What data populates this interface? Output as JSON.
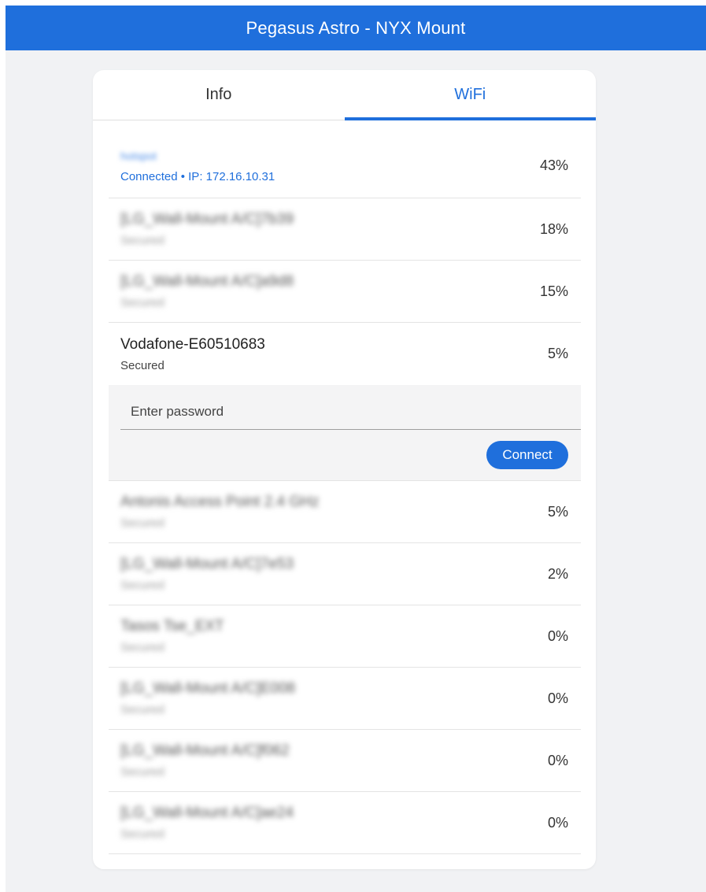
{
  "header": {
    "title": "Pegasus Astro - NYX Mount"
  },
  "tabs": [
    {
      "label": "Info",
      "active": false
    },
    {
      "label": "WiFi",
      "active": true
    }
  ],
  "colors": {
    "accent": "#1f6fdc",
    "background": "#f1f2f4"
  },
  "networks": [
    {
      "ssid": "hotspot",
      "status": "Connected • IP: 172.16.10.31",
      "signal": "43%",
      "connected": true,
      "blurred": true
    },
    {
      "ssid": "[LG_Wall-Mount A/C]7b39",
      "status": "Secured",
      "signal": "18%",
      "blurred": true
    },
    {
      "ssid": "[LG_Wall-Mount A/C]a9d8",
      "status": "Secured",
      "signal": "15%",
      "blurred": true
    },
    {
      "ssid": "Vodafone-E60510683",
      "status": "Secured",
      "signal": "5%",
      "blurred": false,
      "selected": true
    },
    {
      "ssid": "Antonis Access Point 2.4 GHz",
      "status": "Secured",
      "signal": "5%",
      "blurred": true
    },
    {
      "ssid": "[LG_Wall-Mount A/C]7e53",
      "status": "Secured",
      "signal": "2%",
      "blurred": true
    },
    {
      "ssid": "Tasos Tse_EXT",
      "status": "Secured",
      "signal": "0%",
      "blurred": true
    },
    {
      "ssid": "[LG_Wall-Mount A/C]E008",
      "status": "Secured",
      "signal": "0%",
      "blurred": true
    },
    {
      "ssid": "[LG_Wall-Mount A/C]f062",
      "status": "Secured",
      "signal": "0%",
      "blurred": true
    },
    {
      "ssid": "[LG_Wall-Mount A/C]ae24",
      "status": "Secured",
      "signal": "0%",
      "blurred": true
    }
  ],
  "password_panel": {
    "placeholder": "Enter password",
    "value": "",
    "connect_label": "Connect"
  }
}
